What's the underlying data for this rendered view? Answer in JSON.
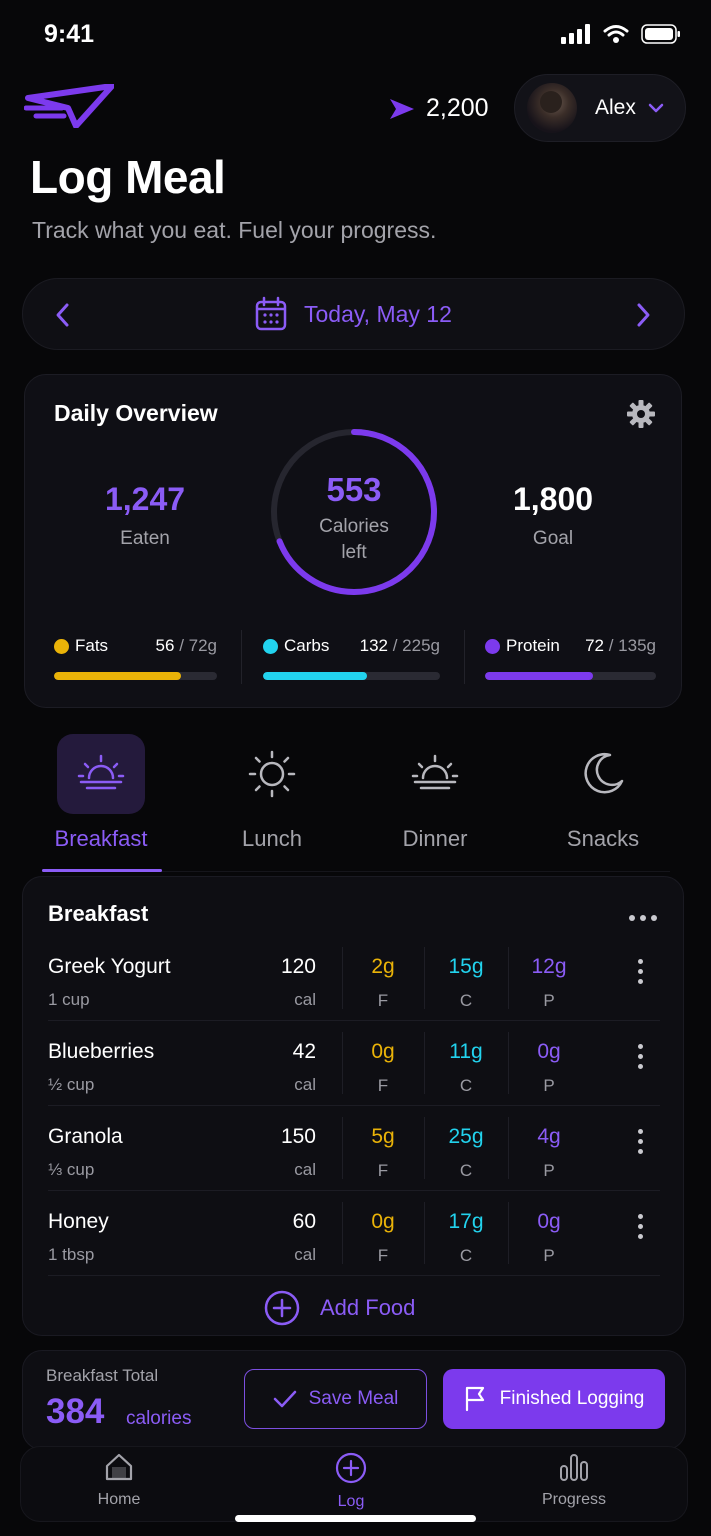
{
  "status_bar": {
    "time": "9:41"
  },
  "header": {
    "points": "2,200",
    "user_name": "Alex",
    "title": "Log Meal",
    "subtitle": "Track what you eat. Fuel your progress."
  },
  "date_nav": {
    "label": "Today, May 12"
  },
  "overview": {
    "title": "Daily Overview",
    "eaten": {
      "value": "1,247",
      "label": "Eaten"
    },
    "remaining": {
      "value": "553",
      "label_line1": "Calories",
      "label_line2": "left",
      "fraction": 0.69
    },
    "goal": {
      "value": "1,800",
      "label": "Goal"
    },
    "macros": [
      {
        "name": "Fats",
        "current": "56",
        "total": "/ 72g",
        "fraction": 0.78,
        "color": "#eab308"
      },
      {
        "name": "Carbs",
        "current": "132",
        "total": "/ 225g",
        "fraction": 0.59,
        "color": "#22d3ee"
      },
      {
        "name": "Protein",
        "current": "72",
        "total": "/ 135g",
        "fraction": 0.63,
        "color": "#7c3aed"
      }
    ]
  },
  "meal_tabs": [
    {
      "label": "Breakfast",
      "icon": "sunrise-icon",
      "active": true
    },
    {
      "label": "Lunch",
      "icon": "sun-icon",
      "active": false
    },
    {
      "label": "Dinner",
      "icon": "sunset-icon",
      "active": false
    },
    {
      "label": "Snacks",
      "icon": "moon-icon",
      "active": false
    }
  ],
  "meal": {
    "title": "Breakfast",
    "foods": [
      {
        "name": "Greek Yogurt",
        "qty": "1 cup",
        "cal": "120",
        "cal_unit": "cal",
        "f": "2g",
        "c": "15g",
        "p": "12g"
      },
      {
        "name": "Blueberries",
        "qty": "½ cup",
        "cal": "42",
        "cal_unit": "cal",
        "f": "0g",
        "c": "11g",
        "p": "0g"
      },
      {
        "name": "Granola",
        "qty": "⅓ cup",
        "cal": "150",
        "cal_unit": "cal",
        "f": "5g",
        "c": "25g",
        "p": "4g"
      },
      {
        "name": "Honey",
        "qty": "1 tbsp",
        "cal": "60",
        "cal_unit": "cal",
        "f": "0g",
        "c": "17g",
        "p": "0g"
      }
    ],
    "macro_units": {
      "f": "F",
      "c": "C",
      "p": "P"
    },
    "add_food_label": "Add Food"
  },
  "summary": {
    "label": "Breakfast Total",
    "value": "384",
    "unit": "calories",
    "save_label": "Save Meal",
    "finish_label": "Finished Logging"
  },
  "bottom_nav": [
    {
      "label": "Home",
      "icon": "home-icon",
      "active": false
    },
    {
      "label": "Log",
      "icon": "plus-circle-icon",
      "active": true
    },
    {
      "label": "Progress",
      "icon": "bar-chart-icon",
      "active": false
    }
  ],
  "colors": {
    "accent": "#8b5cf6",
    "fats": "#eab308",
    "carbs": "#22d3ee",
    "protein": "#7c3aed"
  }
}
